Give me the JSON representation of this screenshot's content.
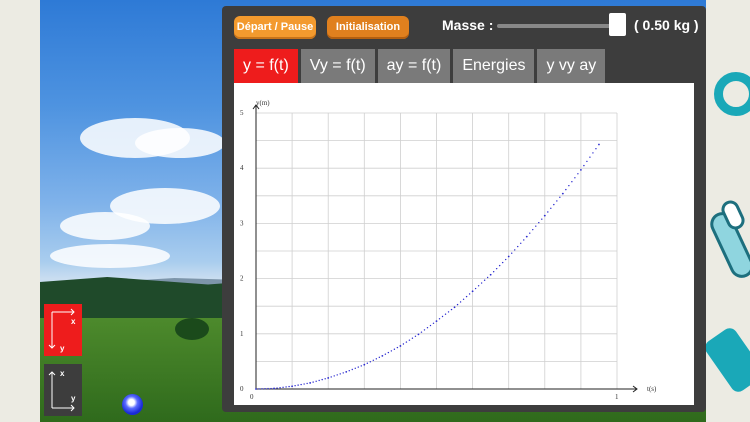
{
  "controls": {
    "start_pause_label": "Départ / Pause",
    "init_label": "Initialisation",
    "mass_label": "Masse :",
    "mass_value": "( 0.50 kg )"
  },
  "tabs": [
    {
      "label": "y = f(t)",
      "active": true
    },
    {
      "label": "Vy = f(t)",
      "active": false
    },
    {
      "label": "ay = f(t)",
      "active": false
    },
    {
      "label": "Energies",
      "active": false
    },
    {
      "label": "y vy ay",
      "active": false
    }
  ],
  "axis_buttons": {
    "btn1": {
      "x_label": "x",
      "y_label": "y"
    },
    "btn2": {
      "x_label": "x",
      "y_label": "y"
    }
  },
  "colors": {
    "accent_orange": "#f39a2e",
    "active_tab": "#ee1c1c",
    "curve": "#2b2bd0"
  },
  "chart_data": {
    "type": "scatter",
    "title": "",
    "xlabel": "t(s)",
    "ylabel": "y(m)",
    "xlim": [
      0,
      1
    ],
    "ylim": [
      0,
      5
    ],
    "x_ticks": [
      "0",
      "1"
    ],
    "y_ticks": [
      "0",
      "1",
      "2",
      "3",
      "4",
      "5"
    ],
    "grid": true,
    "series": [
      {
        "x": [
          0,
          0.05,
          0.1,
          0.15,
          0.2,
          0.25,
          0.3,
          0.35,
          0.4,
          0.45,
          0.5,
          0.55,
          0.6,
          0.65,
          0.7,
          0.75,
          0.8,
          0.85,
          0.9,
          0.95
        ],
        "y": [
          0,
          0.01,
          0.05,
          0.11,
          0.2,
          0.31,
          0.44,
          0.6,
          0.78,
          0.99,
          1.23,
          1.48,
          1.77,
          2.07,
          2.4,
          2.76,
          3.14,
          3.54,
          3.97,
          4.43
        ]
      }
    ]
  }
}
